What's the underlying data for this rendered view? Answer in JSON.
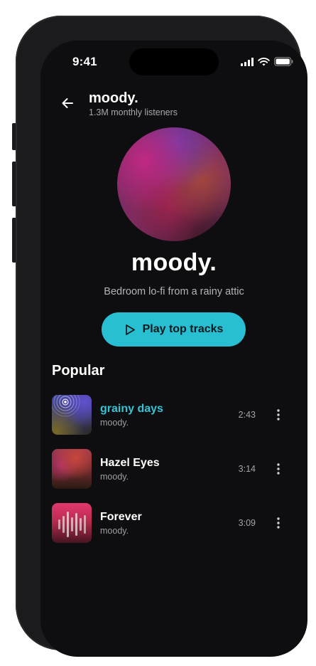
{
  "status_bar": {
    "time": "9:41",
    "icons": [
      "signal-icon",
      "wifi-icon",
      "battery-icon"
    ]
  },
  "header": {
    "title": "moody.",
    "subtitle": "1.3M monthly listeners",
    "back_icon": "arrow-left-icon"
  },
  "artist": {
    "name": "moody.",
    "bio": "Bedroom lo-fi from a rainy attic"
  },
  "play_button": {
    "label": "Play top tracks",
    "icon": "play-icon"
  },
  "popular": {
    "title": "Popular",
    "tracks": [
      {
        "title": "grainy days",
        "artist": "moody.",
        "duration": "2:43",
        "now_playing": true
      },
      {
        "title": "Hazel Eyes",
        "artist": "moody.",
        "duration": "3:14",
        "now_playing": false
      },
      {
        "title": "Forever",
        "artist": "moody.",
        "duration": "3:09",
        "now_playing": false
      }
    ]
  },
  "colors": {
    "accent": "#27bfd1",
    "active_track_title": "#35c3d6",
    "background": "#0e0e10",
    "frame": "#1b1b1d"
  }
}
